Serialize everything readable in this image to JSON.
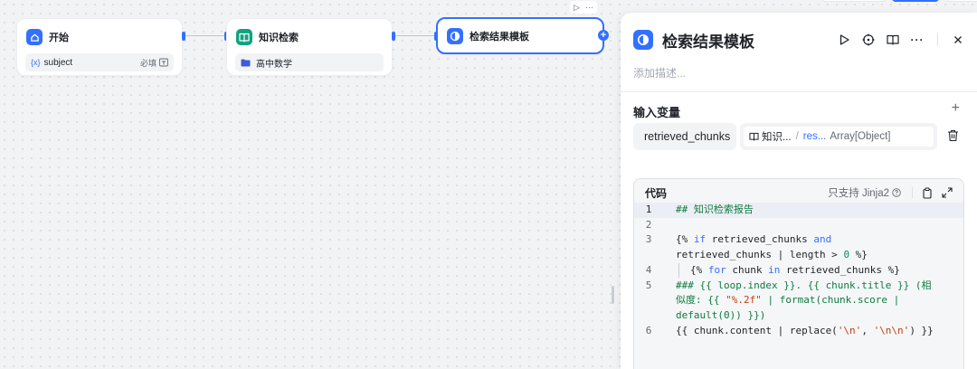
{
  "nodes": {
    "start": {
      "title": "开始",
      "var_name": "subject",
      "required": "必填"
    },
    "knowledge": {
      "title": "知识检索",
      "kb_name": "高中数学"
    },
    "template": {
      "title": "检索结果模板"
    }
  },
  "panel": {
    "title": "检索结果模板",
    "desc_placeholder": "添加描述...",
    "inputs_title": "输入变量",
    "var_name": "retrieved_chunks",
    "ref_node": "知识...",
    "ref_field": "res...",
    "ref_type": "Array[Object]",
    "code_label": "代码",
    "code_note": "只支持 Jinja2"
  },
  "code": {
    "line_numbers": [
      "1",
      "2",
      "3",
      "4",
      "5",
      "6"
    ],
    "line1": "## 知识检索报告",
    "l3a_open": "{% ",
    "l3a_kw": "if",
    "l3a_rest": " retrieved_chunks ",
    "l3a_kw2": "and",
    "l3b_text": "retrieved_chunks | length > ",
    "l3b_num": "0",
    "l3b_close": " %}",
    "l4_open": "{% ",
    "l4_kw": "for",
    "l4_mid": " chunk ",
    "l4_kw2": "in",
    "l4_rest": " retrieved_chunks %}",
    "l5a": "### {{ loop.index }}. {{ chunk.title }} (相",
    "l5b_pre": "似度: {{ ",
    "l5b_str": "\"%.2f\"",
    "l5b_post": " | format(chunk.score |",
    "l5c": "default(0)) }})",
    "l6_pre": "{{ chunk.content | replace(",
    "l6_s1": "'\\n'",
    "l6_mid": ", ",
    "l6_s2": "'\\n\\n'",
    "l6_post": ") }}"
  },
  "colors": {
    "accent": "#3370ff",
    "start_icon": "#3370ff",
    "knowledge_icon": "#0fa37f"
  }
}
